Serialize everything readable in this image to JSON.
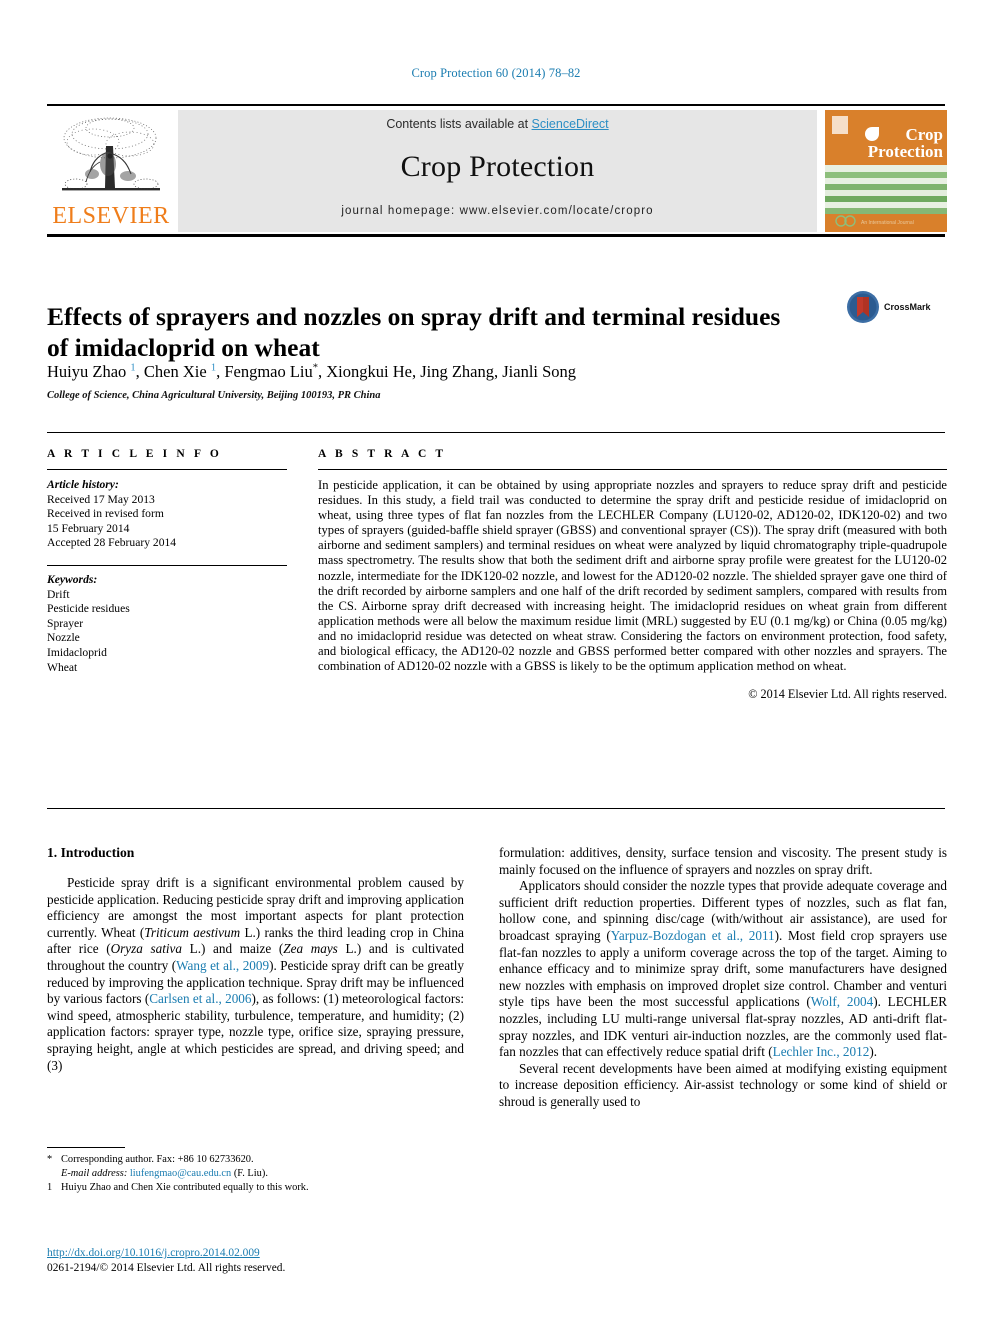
{
  "running_head": "Crop Protection 60 (2014) 78–82",
  "journal_header": {
    "contents_prefix": "Contents lists available at ",
    "contents_link": "ScienceDirect",
    "journal_name": "Crop Protection",
    "homepage": "journal homepage: www.elsevier.com/locate/cropro",
    "publisher_wordmark": "ELSEVIER",
    "cover_title_line1": "Crop",
    "cover_title_line2": "Protection",
    "cover_footer_text": "An International Journal",
    "accent_link_color": "#2c8ec4",
    "cover_bg_color": "#d9802b",
    "elsevier_orange": "#ef7d1a"
  },
  "article": {
    "title": "Effects of sprayers and nozzles on spray drift and terminal residues of imidacloprid on wheat",
    "authors_html": "Huiyu Zhao <sup>1</sup>, Chen Xie <sup>1</sup>, Fengmao Liu<sup class=\"star\">*</sup>, Xiongkui He, Jing Zhang, Jianli Song",
    "affiliation": "College of Science, China Agricultural University, Beijing 100193, PR China",
    "crossmark_label": "CrossMark"
  },
  "article_info": {
    "heading": "A R T I C L E  I N F O",
    "history_label": "Article history:",
    "history": [
      "Received 17 May 2013",
      "Received in revised form",
      "15 February 2014",
      "Accepted 28 February 2014"
    ],
    "keywords_label": "Keywords:",
    "keywords": [
      "Drift",
      "Pesticide residues",
      "Sprayer",
      "Nozzle",
      "Imidacloprid",
      "Wheat"
    ]
  },
  "abstract": {
    "heading": "A B S T R A C T",
    "text": "In pesticide application, it can be obtained by using appropriate nozzles and sprayers to reduce spray drift and pesticide residues. In this study, a field trail was conducted to determine the spray drift and pesticide residue of imidacloprid on wheat, using three types of flat fan nozzles from the LECHLER Company (LU120-02, AD120-02, IDK120-02) and two types of sprayers (guided-baffle shield sprayer (GBSS) and conventional sprayer (CS)). The spray drift (measured with both airborne and sediment samplers) and terminal residues on wheat were analyzed by liquid chromatography triple-quadrupole mass spectrometry. The results show that both the sediment drift and airborne spray profile were greatest for the LU120-02 nozzle, intermediate for the IDK120-02 nozzle, and lowest for the AD120-02 nozzle. The shielded sprayer gave one third of the drift recorded by airborne samplers and one half of the drift recorded by sediment samplers, compared with results from the CS. Airborne spray drift decreased with increasing height. The imidacloprid residues on wheat grain from different application methods were all below the maximum residue limit (MRL) suggested by EU (0.1 mg/kg) or China (0.05 mg/kg) and no imidacloprid residue was detected on wheat straw. Considering the factors on environment protection, food safety, and biological efficacy, the AD120-02 nozzle and GBSS performed better compared with other nozzles and sprayers. The combination of AD120-02 nozzle with a GBSS is likely to be the optimum application method on wheat.",
    "copyright": "© 2014 Elsevier Ltd. All rights reserved."
  },
  "body": {
    "section1_heading": "1. Introduction",
    "left_paragraph_1_html": "Pesticide spray drift is a significant environmental problem caused by pesticide application. Reducing pesticide spray drift and improving application efficiency are amongst the most important aspects for plant protection currently. Wheat (<i>Triticum aestivum</i> L.) ranks the third leading crop in China after rice (<i>Oryza sativa</i> L.) and maize (<i>Zea mays</i> L.) and is cultivated throughout the country (<span class=\"ref\">Wang et al., 2009</span>). Pesticide spray drift can be greatly reduced by improving the application technique. Spray drift may be influenced by various factors (<span class=\"ref\">Carlsen et al., 2006</span>), as follows: (1) meteorological factors: wind speed, atmospheric stability, turbulence, temperature, and humidity; (2) application factors: sprayer type, nozzle type, orifice size, spraying pressure, spraying height, angle at which pesticides are spread, and driving speed; and (3)",
    "right_paragraph_1_html": "formulation: additives, density, surface tension and viscosity. The present study is mainly focused on the influence of sprayers and nozzles on spray drift.",
    "right_paragraph_2_html": "Applicators should consider the nozzle types that provide adequate coverage and sufficient drift reduction properties. Different types of nozzles, such as flat fan, hollow cone, and spinning disc/cage (with/without air assistance), are used for broadcast spraying (<span class=\"ref\">Yarpuz-Bozdogan et al., 2011</span>). Most field crop sprayers use flat-fan nozzles to apply a uniform coverage across the top of the target. Aiming to enhance efficacy and to minimize spray drift, some manufacturers have designed new nozzles with emphasis on improved droplet size control. Chamber and venturi style tips have been the most successful applications (<span class=\"ref\">Wolf, 2004</span>). LECHLER nozzles, including LU multi-range universal flat-spray nozzles, AD anti-drift flat-spray nozzles, and IDK venturi air-induction nozzles, are the commonly used flat-fan nozzles that can effectively reduce spatial drift (<span class=\"ref\">Lechler Inc., 2012</span>).",
    "right_paragraph_3_html": "Several recent developments have been aimed at modifying existing equipment to increase deposition efficiency. Air-assist technology or some kind of shield or shroud is generally used to"
  },
  "footnotes": {
    "corresponding_marker": "*",
    "corresponding_text": "Corresponding author. Fax: +86 10 62733620.",
    "email_label": "E-mail address:",
    "email": "liufengmao@cau.edu.cn",
    "email_suffix": "(F. Liu).",
    "equal_marker": "1",
    "equal_text": "Huiyu Zhao and Chen Xie contributed equally to this work."
  },
  "publication": {
    "doi_url": "http://dx.doi.org/10.1016/j.cropro.2014.02.009",
    "issn_line": "0261-2194/© 2014 Elsevier Ltd. All rights reserved."
  }
}
